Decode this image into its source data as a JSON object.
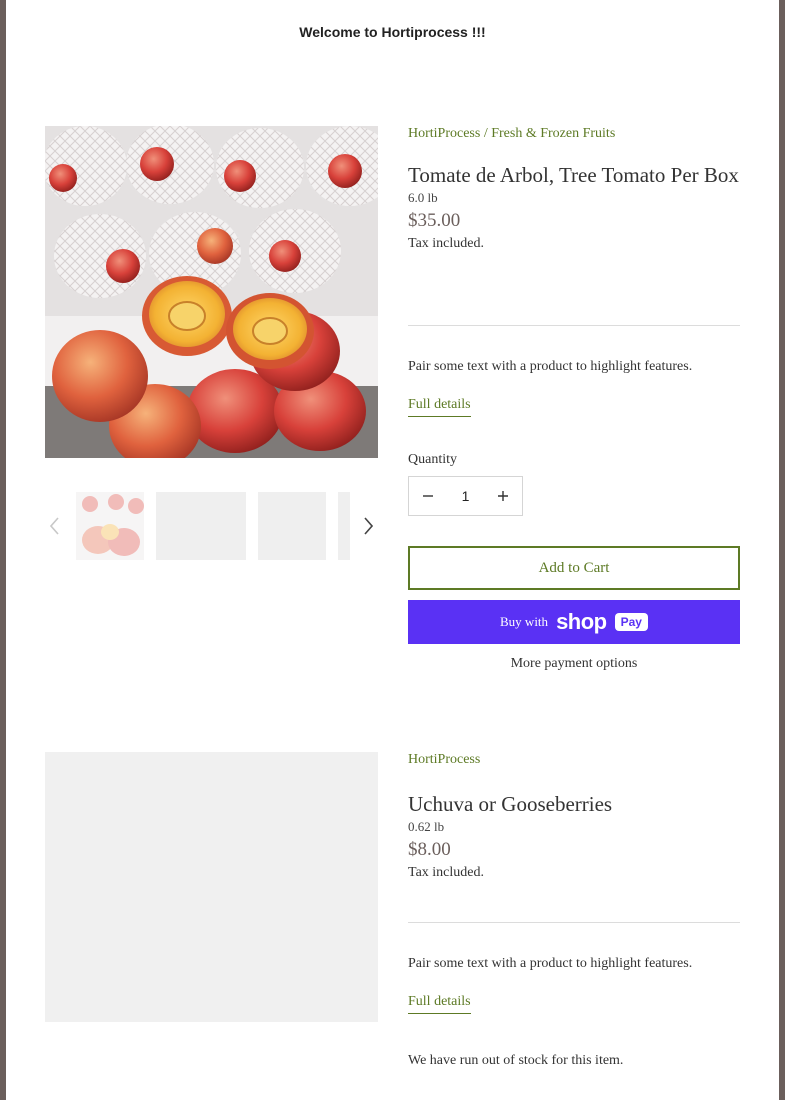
{
  "banner": {
    "text": "Welcome to Hortiprocess !!!"
  },
  "product1": {
    "breadcrumb_home": "HortiProcess",
    "breadcrumb_sep": "/",
    "breadcrumb_collection": "Fresh & Frozen Fruits",
    "title": "Tomate de Arbol, Tree Tomato Per Box",
    "weight": "6.0 lb",
    "price": "$35.00",
    "tax": "Tax included.",
    "description": "Pair some text with a product to highlight features.",
    "full_details": "Full details",
    "quantity_label": "Quantity",
    "quantity_value": "1",
    "add_to_cart": "Add to Cart",
    "buy_with": "Buy with",
    "shop_word": "shop",
    "pay_word": "Pay",
    "more_payment": "More payment options"
  },
  "product2": {
    "breadcrumb_home": "HortiProcess",
    "title": "Uchuva or Gooseberries",
    "weight": "0.62 lb",
    "price": "$8.00",
    "tax": "Tax included.",
    "description": "Pair some text with a product to highlight features.",
    "full_details": "Full details",
    "out_of_stock": "We have run out of stock for this item."
  },
  "colors": {
    "accent": "#5d7a25",
    "shop_pay": "#5a31f4",
    "price": "#6b5f5c",
    "frame": "#6b5f5c"
  }
}
